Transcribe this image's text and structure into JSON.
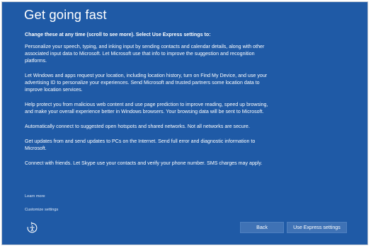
{
  "page": {
    "title": "Get going fast",
    "intro": "Change these at any time (scroll to see more). Select Use Express settings to:",
    "paragraphs": [
      "Personalize your speech, typing, and inking input by sending contacts and calendar details, along with other associated input data to Microsoft. Let Microsoft use that info to improve the suggestion and recognition platforms.",
      "Let Windows and apps request your location, including location history, turn on Find My Device, and use your advertising ID to personalize your experiences. Send Microsoft and trusted partners some location data to improve location services.",
      "Help protect you from malicious web content and use page prediction to improve reading, speed up browsing, and make your overall experience better in Windows browsers. Your browsing data will be sent to Microsoft.",
      "Automatically connect to suggested open hotspots and shared networks. Not all networks are secure.",
      "Get updates from and send updates to PCs on the Internet. Send full error and diagnostic information to Microsoft.",
      "Connect with friends. Let Skype use your contacts and verify your phone number. SMS charges may apply."
    ]
  },
  "links": {
    "learn_more": "Learn more",
    "customize": "Customize settings"
  },
  "buttons": {
    "back": "Back",
    "express": "Use Express settings"
  },
  "icons": {
    "accessibility": "ease-of-access-icon"
  },
  "colors": {
    "background": "#1f5aa6",
    "button": "#3f72b5",
    "text": "#ffffff"
  }
}
